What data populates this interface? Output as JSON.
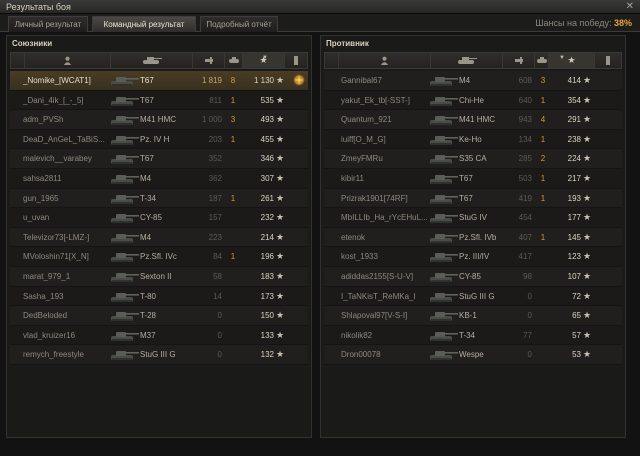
{
  "window": {
    "title": "Результаты боя",
    "close_glyph": "✕"
  },
  "tabs": [
    {
      "label": "Личный результат"
    },
    {
      "label": "Командный результат"
    },
    {
      "label": "Подробный отчёт"
    }
  ],
  "win_chance": {
    "label": "Шансы на победу:",
    "value": "38%"
  },
  "allies": {
    "title": "Союзники",
    "rows": [
      {
        "player": "_Nomike_[WCAT1]",
        "tank": "T67",
        "damage": "1 819",
        "kills": "8",
        "xp": "1 130",
        "highlight": true,
        "medal": true
      },
      {
        "player": "_Dani_4ik_[_-_5]",
        "tank": "T67",
        "damage": "811",
        "kills": "1",
        "xp": "535"
      },
      {
        "player": "adm_PVSh",
        "tank": "M41 HMC",
        "damage": "1 000",
        "kills": "3",
        "xp": "493"
      },
      {
        "player": "DeaD_AnGeL_TaBiS...",
        "tank": "Pz. IV H",
        "damage": "203",
        "kills": "1",
        "xp": "455"
      },
      {
        "player": "malevich__varabey",
        "tank": "T67",
        "damage": "352",
        "kills": "",
        "xp": "346"
      },
      {
        "player": "sahsa2811",
        "tank": "M4",
        "damage": "362",
        "kills": "",
        "xp": "307"
      },
      {
        "player": "gun_1965",
        "tank": "T-34",
        "damage": "187",
        "kills": "1",
        "xp": "261"
      },
      {
        "player": "u_uvan",
        "tank": "CY-85",
        "damage": "157",
        "kills": "",
        "xp": "232"
      },
      {
        "player": "Televizor73[-LMZ-]",
        "tank": "M4",
        "damage": "223",
        "kills": "",
        "xp": "214"
      },
      {
        "player": "MVoloshin71[X_N]",
        "tank": "Pz.Sfl. IVc",
        "damage": "84",
        "kills": "1",
        "xp": "196"
      },
      {
        "player": "marat_979_1",
        "tank": "Sexton II",
        "damage": "58",
        "kills": "",
        "xp": "183"
      },
      {
        "player": "Sasha_193",
        "tank": "T-80",
        "damage": "14",
        "kills": "",
        "xp": "173"
      },
      {
        "player": "DedBeloded",
        "tank": "T-28",
        "damage": "0",
        "kills": "",
        "xp": "150"
      },
      {
        "player": "vlad_kruizer16",
        "tank": "M37",
        "damage": "0",
        "kills": "",
        "xp": "133"
      },
      {
        "player": "remych_freestyle",
        "tank": "StuG III G",
        "damage": "0",
        "kills": "",
        "xp": "132"
      }
    ]
  },
  "enemies": {
    "title": "Противник",
    "rows": [
      {
        "player": "Gannibal67",
        "tank": "M4",
        "damage": "608",
        "kills": "3",
        "xp": "414"
      },
      {
        "player": "yakut_Ek_tb[-SST-]",
        "tank": "Chi-He",
        "damage": "640",
        "kills": "1",
        "xp": "354"
      },
      {
        "player": "Quantum_921",
        "tank": "M41 HMC",
        "damage": "943",
        "kills": "4",
        "xp": "291"
      },
      {
        "player": "iuiff[O_M_G]",
        "tank": "Ke-Ho",
        "damage": "134",
        "kills": "1",
        "xp": "238"
      },
      {
        "player": "ZmeyFMRu",
        "tank": "S35 CA",
        "damage": "285",
        "kills": "2",
        "xp": "224"
      },
      {
        "player": "kibir11",
        "tank": "T67",
        "damage": "503",
        "kills": "1",
        "xp": "217"
      },
      {
        "player": "Prizrak1901[74RF]",
        "tank": "T67",
        "damage": "419",
        "kills": "1",
        "xp": "193"
      },
      {
        "player": "MbILLIb_Ha_rYcEHuL...",
        "tank": "StuG IV",
        "damage": "454",
        "kills": "",
        "xp": "177"
      },
      {
        "player": "etenok",
        "tank": "Pz.Sfl. IVb",
        "damage": "407",
        "kills": "1",
        "xp": "145"
      },
      {
        "player": "kost_1933",
        "tank": "Pz. III/IV",
        "damage": "417",
        "kills": "",
        "xp": "123"
      },
      {
        "player": "adiddas2155[S-U-V]",
        "tank": "CY-85",
        "damage": "98",
        "kills": "",
        "xp": "107"
      },
      {
        "player": "I_TaNKisT_ReMKa_I",
        "tank": "StuG III G",
        "damage": "0",
        "kills": "",
        "xp": "72"
      },
      {
        "player": "Shlapoval97[V-S-I]",
        "tank": "KB-1",
        "damage": "0",
        "kills": "",
        "xp": "65"
      },
      {
        "player": "nikolik82",
        "tank": "T-34",
        "damage": "77",
        "kills": "",
        "xp": "57"
      },
      {
        "player": "Dron00078",
        "tank": "Wespe",
        "damage": "0",
        "kills": "",
        "xp": "53"
      }
    ]
  },
  "colors": {
    "accent": "#e7a339",
    "kills": "#d79b2c",
    "highlight_row": "#4a3c26"
  },
  "icons": {
    "star": "★",
    "player_col": "player-icon",
    "tank_col": "tank-icon",
    "damage_col": "damage-icon",
    "kills_col": "kills-icon",
    "xp_col": "xp-star-icon",
    "medal_col": "medal-icon"
  }
}
